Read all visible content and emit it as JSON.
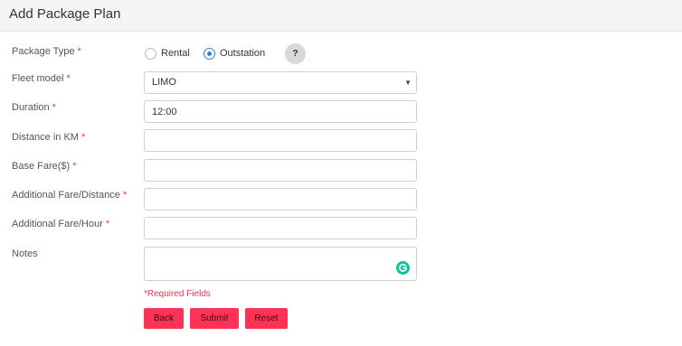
{
  "header": {
    "title": "Add Package Plan"
  },
  "form": {
    "required_marker": "*",
    "package_type": {
      "label": "Package Type",
      "options": [
        "Rental",
        "Outstation"
      ],
      "selected": "Outstation"
    },
    "fleet_model": {
      "label": "Fleet model",
      "value": "LIMO"
    },
    "duration": {
      "label": "Duration",
      "value": "12:00"
    },
    "distance": {
      "label": "Distance in KM",
      "value": ""
    },
    "base_fare": {
      "label": "Base Fare($)",
      "value": ""
    },
    "additional_fare_distance": {
      "label": "Additional Fare/Distance",
      "value": ""
    },
    "additional_fare_hour": {
      "label": "Additional Fare/Hour",
      "value": ""
    },
    "notes": {
      "label": "Notes",
      "value": ""
    },
    "help_label": "?",
    "required_note": "*Required Fields"
  },
  "buttons": {
    "back": "Back",
    "submit": "Submit",
    "reset": "Reset"
  },
  "colors": {
    "accent": "#ff3355",
    "required": "#e03a4f",
    "radio": "#2f7fd0",
    "grammarly": "#15c39a"
  }
}
